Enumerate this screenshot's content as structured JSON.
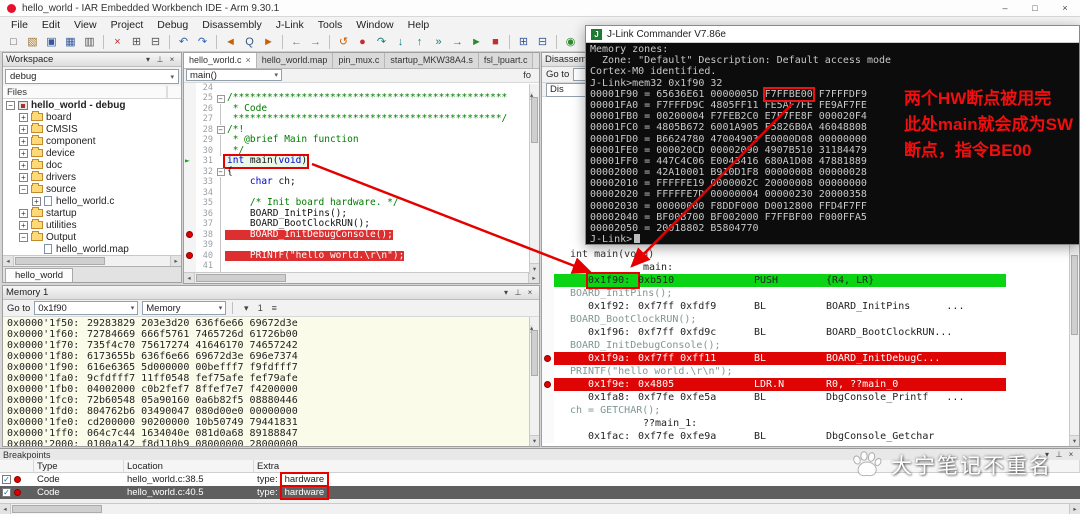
{
  "titlebar": {
    "title": "hello_world - IAR Embedded Workbench IDE - Arm 9.30.1",
    "controls": [
      {
        "name": "minimize-button",
        "glyph": "–"
      },
      {
        "name": "maximize-button",
        "glyph": "□"
      },
      {
        "name": "close-button",
        "glyph": "×"
      }
    ]
  },
  "menubar": {
    "items": [
      "File",
      "Edit",
      "View",
      "Project",
      "Debug",
      "Disassembly",
      "J-Link",
      "Tools",
      "Window",
      "Help"
    ]
  },
  "toolbar": {
    "icons": [
      {
        "name": "new-document-icon",
        "glyph": "□",
        "color": "#555"
      },
      {
        "name": "open-file-icon",
        "glyph": "▧",
        "color": "#a07830"
      },
      {
        "name": "save-icon",
        "glyph": "▣",
        "color": "#35589a"
      },
      {
        "name": "save-all-icon",
        "glyph": "▦",
        "color": "#35589a"
      },
      {
        "name": "print-icon",
        "glyph": "▥",
        "color": "#555"
      },
      {
        "sep": true
      },
      {
        "name": "cut-icon",
        "glyph": "×",
        "color": "#b03030"
      },
      {
        "name": "copy-icon",
        "glyph": "⊞",
        "color": "#555"
      },
      {
        "name": "paste-icon",
        "glyph": "⊟",
        "color": "#555"
      },
      {
        "sep": true
      },
      {
        "name": "undo-icon",
        "glyph": "↶",
        "color": "#2b5fb0"
      },
      {
        "name": "redo-icon",
        "glyph": "↷",
        "color": "#2b5fb0"
      },
      {
        "sep": true
      },
      {
        "name": "find-previous-icon",
        "glyph": "◄",
        "color": "#c95f00"
      },
      {
        "name": "search-icon",
        "glyph": "Q",
        "color": "#3a5a80"
      },
      {
        "name": "find-next-icon",
        "glyph": "►",
        "color": "#c95f00"
      },
      {
        "sep": true
      },
      {
        "name": "navigate-back-icon",
        "glyph": "←",
        "color": "#777"
      },
      {
        "name": "navigate-forward-icon",
        "glyph": "→",
        "color": "#777"
      },
      {
        "sep": true
      },
      {
        "name": "reset-icon",
        "glyph": "↺",
        "color": "#c95f00"
      },
      {
        "name": "break-icon",
        "glyph": "●",
        "color": "#c03030"
      },
      {
        "name": "step-over-icon",
        "glyph": "↷",
        "color": "#0d7f7f"
      },
      {
        "name": "step-into-icon",
        "glyph": "↓",
        "color": "#0d7f7f"
      },
      {
        "name": "step-out-icon",
        "glyph": "↑",
        "color": "#0d7f7f"
      },
      {
        "name": "next-statement-icon",
        "glyph": "»",
        "color": "#0d7f7f"
      },
      {
        "name": "run-to-cursor-icon",
        "glyph": "→",
        "color": "#0d7f7f"
      },
      {
        "name": "go-icon",
        "glyph": "►",
        "color": "#2c8c2c"
      },
      {
        "name": "stop-debug-icon",
        "glyph": "■",
        "color": "#c03030"
      },
      {
        "sep": true
      },
      {
        "name": "window-layout-icon",
        "glyph": "⊞",
        "color": "#35589a"
      },
      {
        "name": "window-split-icon",
        "glyph": "⊟",
        "color": "#35589a"
      },
      {
        "sep": true
      },
      {
        "name": "power-icon",
        "glyph": "◉",
        "color": "#2c8c2c"
      },
      {
        "name": "connection-icon",
        "glyph": "◎",
        "color": "#0d7f7f"
      },
      {
        "name": "status-led-icon",
        "glyph": "●",
        "color": "#2c8c2c"
      }
    ]
  },
  "dock_icons": [
    {
      "name": "panel-menu-icon",
      "glyph": "▾"
    },
    {
      "name": "panel-pin-icon",
      "glyph": "⊥"
    },
    {
      "name": "panel-close-icon",
      "glyph": "×"
    }
  ],
  "ui": {
    "dropdown": "▾",
    "scroll_left": "◂",
    "scroll_right": "▸",
    "scroll_up": "▴",
    "scroll_down": "▾"
  },
  "workspace": {
    "title": "Workspace",
    "config": "debug",
    "files_header": "Files",
    "doc_tab": "hello_world",
    "tree": [
      {
        "label": "hello_world - debug",
        "level": 0,
        "exp": "−",
        "icon": "project",
        "bold": true
      },
      {
        "label": "board",
        "level": 1,
        "exp": "+",
        "icon": "folder"
      },
      {
        "label": "CMSIS",
        "level": 1,
        "exp": "+",
        "icon": "folder"
      },
      {
        "label": "component",
        "level": 1,
        "exp": "+",
        "icon": "folder"
      },
      {
        "label": "device",
        "level": 1,
        "exp": "+",
        "icon": "folder"
      },
      {
        "label": "doc",
        "level": 1,
        "exp": "+",
        "icon": "folder"
      },
      {
        "label": "drivers",
        "level": 1,
        "exp": "+",
        "icon": "folder"
      },
      {
        "label": "source",
        "level": 1,
        "exp": "−",
        "icon": "folder"
      },
      {
        "label": "hello_world.c",
        "level": 2,
        "exp": "+",
        "icon": "file"
      },
      {
        "label": "startup",
        "level": 1,
        "exp": "+",
        "icon": "folder"
      },
      {
        "label": "utilities",
        "level": 1,
        "exp": "+",
        "icon": "folder"
      },
      {
        "label": "Output",
        "level": 1,
        "exp": "−",
        "icon": "folder"
      },
      {
        "label": "hello_world.map",
        "level": 2,
        "exp": "",
        "icon": "file"
      }
    ]
  },
  "editor": {
    "tabs": [
      {
        "label": "hello_world.c",
        "active": true
      },
      {
        "label": "hello_world.map"
      },
      {
        "label": "pin_mux.c"
      },
      {
        "label": "startup_MKW38A4.s"
      },
      {
        "label": "fsl_lpuart.c"
      }
    ],
    "tab_close_glyph": "×",
    "function_selector": "main()",
    "corner_label": "fo",
    "current_statement_glyph": "►",
    "lines": [
      {
        "n": "24",
        "code": "",
        "cls": "",
        "fold": ""
      },
      {
        "n": "25",
        "code": "/************************************************",
        "cls": "comment",
        "fold": "−"
      },
      {
        "n": "26",
        "code": " * Code",
        "cls": "comment",
        "fold": "|"
      },
      {
        "n": "27",
        "code": " ***********************************************/",
        "cls": "comment",
        "fold": "|"
      },
      {
        "n": "28",
        "code": "/*!",
        "cls": "comment",
        "fold": "−"
      },
      {
        "n": "29",
        "code": " * @brief Main function",
        "cls": "comment",
        "fold": "|"
      },
      {
        "n": "30",
        "code": " */",
        "cls": "comment",
        "fold": "|"
      },
      {
        "n": "31",
        "segs": [
          {
            "t": "int",
            "c": "kw"
          },
          {
            "t": " main(",
            "c": ""
          },
          {
            "t": "void",
            "c": "kw"
          },
          {
            "t": ")",
            "c": ""
          }
        ],
        "cur": true,
        "boxed": true,
        "fold": ""
      },
      {
        "n": "32",
        "code": "{",
        "cls": "",
        "fold": "−"
      },
      {
        "n": "33",
        "segs": [
          {
            "t": "    ",
            "c": ""
          },
          {
            "t": "char",
            "c": "kw"
          },
          {
            "t": " ch;",
            "c": ""
          }
        ],
        "fold": "|"
      },
      {
        "n": "34",
        "code": "",
        "cls": "",
        "fold": "|"
      },
      {
        "n": "35",
        "code": "    /* Init board hardware. */",
        "cls": "comment",
        "fold": "|"
      },
      {
        "n": "36",
        "code": "    BOARD_InitPins();",
        "cls": "",
        "fold": "|"
      },
      {
        "n": "37",
        "code": "    BOARD_BootClockRUN();",
        "cls": "",
        "fold": "|"
      },
      {
        "n": "38",
        "code": "    BOARD_InitDebugConsole();",
        "cls": "",
        "fold": "|",
        "bp": true
      },
      {
        "n": "39",
        "code": "",
        "cls": "",
        "fold": "|"
      },
      {
        "n": "40",
        "segs": [
          {
            "t": "    PRINTF(",
            "c": ""
          },
          {
            "t": "\"hello world.\\r\\n\"",
            "c": "str"
          },
          {
            "t": ");",
            "c": ""
          }
        ],
        "fold": "|",
        "bp": true
      },
      {
        "n": "41",
        "code": "",
        "cls": "",
        "fold": "|"
      }
    ]
  },
  "disassembly": {
    "panel_title": "Disassembly",
    "goto_label": "Go to",
    "zone_value": "",
    "mode_value": "Dis",
    "rows": [
      {
        "kind": "src-strong",
        "text": "int main(void)"
      },
      {
        "kind": "label",
        "text": "main:"
      },
      {
        "kind": "current",
        "addr": "0x1f90:",
        "code": "0xb510",
        "mnem": "PUSH",
        "ops": "{R4, LR}",
        "boxed": true
      },
      {
        "kind": "src",
        "text": "BOARD_InitPins();"
      },
      {
        "kind": "asm",
        "addr": "0x1f92:",
        "code": "0xf7ff 0xfdf9",
        "mnem": "BL",
        "ops": "BOARD_InitPins      ..."
      },
      {
        "kind": "src",
        "text": "BOARD_BootClockRUN();"
      },
      {
        "kind": "asm",
        "addr": "0x1f96:",
        "code": "0xf7ff 0xfd9c",
        "mnem": "BL",
        "ops": "BOARD_BootClockRUN..."
      },
      {
        "kind": "src",
        "text": "BOARD_InitDebugConsole();"
      },
      {
        "kind": "bp",
        "addr": "0x1f9a:",
        "code": "0xf7ff 0xff11",
        "mnem": "BL",
        "ops": "BOARD_InitDebugC..."
      },
      {
        "kind": "src",
        "text": "PRINTF(\"hello world.\\r\\n\");"
      },
      {
        "kind": "bp",
        "addr": "0x1f9e:",
        "code": "0x4805",
        "mnem": "LDR.N",
        "ops": "R0, ??main_0"
      },
      {
        "kind": "asm",
        "addr": "0x1fa8:",
        "code": "0xf7fe 0xfe5a",
        "mnem": "BL",
        "ops": "DbgConsole_Printf   ..."
      },
      {
        "kind": "src",
        "text": "ch = GETCHAR();"
      },
      {
        "kind": "label",
        "text": "??main_1:"
      },
      {
        "kind": "asm",
        "addr": "0x1fac:",
        "code": "0xf7fe 0xfe9a",
        "mnem": "BL",
        "ops": "DbgConsole_Getchar"
      }
    ]
  },
  "jlink": {
    "title": "J-Link Commander V7.86e",
    "icon_glyph": "J",
    "terminal": [
      {
        "text": "Memory zones:"
      },
      {
        "text": "  Zone: \"Default\" Description: Default access mode"
      },
      {
        "text": "Cortex-M0 identified."
      },
      {
        "text": "J-Link>mem32 0x1f90 32"
      },
      {
        "pre": "00001F90 = 65636E61 0000005D ",
        "boxed": "F7FFBE00",
        "post": " F7FFFDF9"
      },
      {
        "text": "00001FA0 = F7FFFD9C 4805FF11 FE5AF7FE FE9AF7FE"
      },
      {
        "text": "00001FB0 = 00200004 F7FEB2C0 E7F7FE8F 000020F4"
      },
      {
        "text": "00001FC0 = 4805B672 6001A905 F5826B0A 46048808"
      },
      {
        "text": "00001FD0 = B6624780 47004903 E0000D08 00000000"
      },
      {
        "text": "00001FE0 = 000020CD 00002090 4907B510 31184479"
      },
      {
        "text": "00001FF0 = 447C4C06 E0043416 680A1D08 47881889"
      },
      {
        "text": "00002000 = 42A10001 B910D1F8 00000008 00000028"
      },
      {
        "text": "00002010 = FFFFFE19 0000002C 20000008 00000000"
      },
      {
        "text": "00002020 = FFFFFE7D 00000004 00000230 20000358"
      },
      {
        "text": "00002030 = 00000000 F8DDF000 D0012800 FFD4F7FF"
      },
      {
        "text": "00002040 = BF00B700 BF002000 F7FFBF00 F000FFA5"
      },
      {
        "text": "00002050 = 20018802 B5804770"
      },
      {
        "text": "J-Link>",
        "prompt": true
      }
    ],
    "annotation_lines": [
      "两个HW断点被用完",
      "此处main就会成为SW",
      "断点，指令BE00"
    ]
  },
  "memory": {
    "panel_title": "Memory 1",
    "goto_label": "Go to",
    "goto_value": "0x1f90",
    "zone": "Memory",
    "icons": [
      {
        "name": "view-menu-icon",
        "glyph": "▾"
      },
      {
        "name": "unit-size-icon",
        "glyph": "1"
      },
      {
        "name": "columns-icon",
        "glyph": "≡"
      }
    ],
    "rows": [
      {
        "addr": "0x0000'1f50:",
        "data": "29283829 203e3d20 636f6e66 69672d3e"
      },
      {
        "addr": "0x0000'1f60:",
        "data": "72784669 666f5761 7465726d 61726b00"
      },
      {
        "addr": "0x0000'1f70:",
        "data": "735f4c70 75617274 41646170 74657242"
      },
      {
        "addr": "0x0000'1f80:",
        "data": "6173655b 636f6e66 69672d3e 696e7374"
      },
      {
        "addr": "0x0000'1f90:",
        "data": "616e6365 5d000000 00befff7 f9fdfff7"
      },
      {
        "addr": "0x0000'1fa0:",
        "data": "9cfdfff7 11ff0548 fef75afe fef79afe"
      },
      {
        "addr": "0x0000'1fb0:",
        "data": "04002000 c0b2fef7 8ffef7e7 f4200000"
      },
      {
        "addr": "0x0000'1fc0:",
        "data": "72b60548 05a90160 0a6b82f5 08880446"
      },
      {
        "addr": "0x0000'1fd0:",
        "data": "804762b6 03490047 080d00e0 00000000"
      },
      {
        "addr": "0x0000'1fe0:",
        "data": "cd200000 90200000 10b50749 79441831"
      },
      {
        "addr": "0x0000'1ff0:",
        "data": "064c7c44 1634040e 081d0a68 89188847"
      },
      {
        "addr": "0x0000'2000:",
        "data": "0100a142 f8d110b9 08000000 28000000"
      }
    ]
  },
  "breakpoints": {
    "panel_title": "Breakpoints",
    "columns": [
      "Type",
      "Location",
      "Extra"
    ],
    "check_glyph": "✓",
    "rows": [
      {
        "type": "Code",
        "location": "hello_world.c:38.5",
        "extra_prefix": "type:",
        "extra_value": "hardware",
        "selected": false
      },
      {
        "type": "Code",
        "location": "hello_world.c:40.5",
        "extra_prefix": "type:",
        "extra_value": "hardware",
        "selected": true
      }
    ]
  },
  "watermark": {
    "text": "大宁笔记不重名"
  }
}
